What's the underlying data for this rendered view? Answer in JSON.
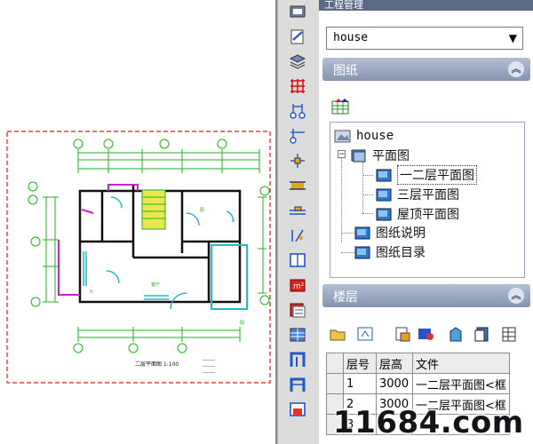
{
  "panel": {
    "title": "工程管理",
    "project_dropdown": {
      "value": "house"
    },
    "drawings_section": {
      "label": "图纸"
    },
    "floors_section": {
      "label": "楼层"
    },
    "tree": {
      "root": "house",
      "plan_group": "平面图",
      "plans": [
        "一二层平面图",
        "三层平面图",
        "屋顶平面图"
      ],
      "others": [
        "图纸说明",
        "图纸目录"
      ]
    },
    "floor_table": {
      "headers": [
        "层号",
        "层高",
        "文件"
      ],
      "rows": [
        {
          "num": "1",
          "height": "3000",
          "file": "一二层平面图<框"
        },
        {
          "num": "2",
          "height": "3000",
          "file": "一二层平面图<框"
        },
        {
          "num": "3",
          "height": "",
          "file": ""
        },
        {
          "num": "4",
          "height": "",
          "file": ""
        }
      ]
    }
  },
  "drawing": {
    "caption": "二层平面图 1:100"
  },
  "colors": {
    "panel_header": "#8694b0",
    "cad_green": "#1db31d",
    "cad_magenta": "#cc22cc",
    "cad_cyan": "#22bbcc",
    "cad_yellow": "#e8e84a",
    "cad_red_dash": "#d81c1c"
  },
  "watermark": "11684.com"
}
